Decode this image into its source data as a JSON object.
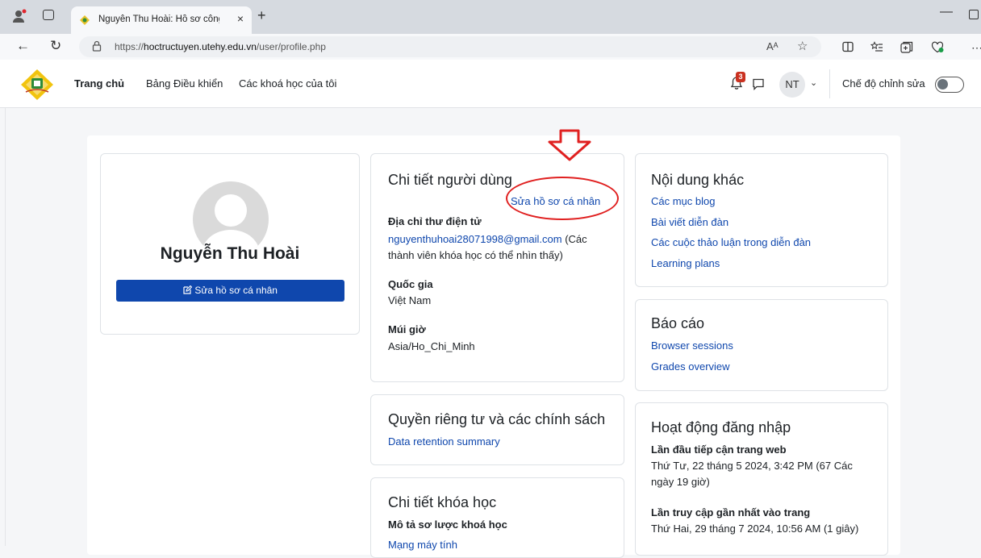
{
  "browser": {
    "tab_title": "Nguyễn Thu Hoài: Hồ sơ công kh",
    "url_scheme": "https://",
    "url_host": "hoctructuyen.utehy.edu.vn",
    "url_path": "/user/profile.php",
    "new_tab": "+",
    "tab_close": "×",
    "reader_label": "Aᴬ"
  },
  "navbar": {
    "links": [
      "Trang chủ",
      "Bảng Điều khiển",
      "Các khoá học của tôi"
    ],
    "notification_count": "3",
    "avatar_initials": "NT",
    "edit_mode_label": "Chế độ chỉnh sửa"
  },
  "profile": {
    "full_name": "Nguyễn Thu Hoài",
    "edit_button": "Sửa hồ sơ cá nhân"
  },
  "user_details": {
    "title": "Chi tiết người dùng",
    "edit_link": "Sửa hồ sơ cá nhân",
    "email_label": "Địa chỉ thư điện tử",
    "email": "nguyenthuhoai28071998@gmail.com",
    "email_note_1": " (Các",
    "email_note_2": "thành viên khóa học có thể nhìn thấy)",
    "country_label": "Quốc gia",
    "country": "Việt Nam",
    "timezone_label": "Múi giờ",
    "timezone": "Asia/Ho_Chi_Minh"
  },
  "privacy": {
    "title": "Quyền riêng tư và các chính sách",
    "link": "Data retention summary"
  },
  "course_details": {
    "title": "Chi tiết khóa học",
    "label": "Mô tả sơ lược khoá học",
    "course": "Mạng máy tính"
  },
  "misc": {
    "title": "Nội dung khác",
    "links": [
      "Các mục blog",
      "Bài viết diễn đàn",
      "Các cuộc thảo luận trong diễn đàn",
      "Learning plans"
    ]
  },
  "reports": {
    "title": "Báo cáo",
    "links": [
      "Browser sessions",
      "Grades overview"
    ]
  },
  "login_activity": {
    "title": "Hoạt động đăng nhập",
    "first_label": "Lần đầu tiếp cận trang web",
    "first_value_1": "Thứ Tư, 22 tháng 5 2024, 3:42 PM  (67 Các",
    "first_value_2": "ngày 19 giờ)",
    "last_label": "Lần truy cập gần nhất vào trang",
    "last_value": "Thứ Hai, 29 tháng 7 2024, 10:56 AM  (1 giây)"
  },
  "colors": {
    "link": "#0f47ad",
    "button": "#0f47ad",
    "annotation": "#e02020",
    "badge": "#ca3120"
  }
}
